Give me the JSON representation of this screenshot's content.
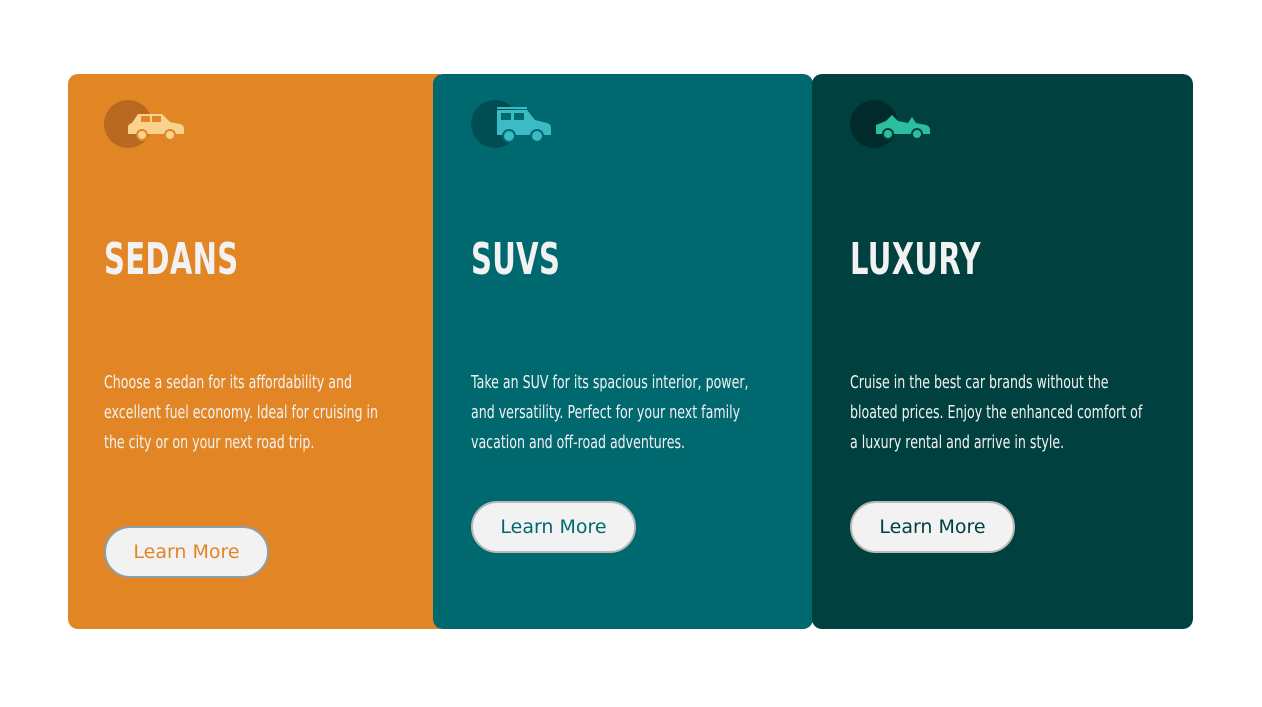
{
  "cards": [
    {
      "id": "sedans",
      "title": "SEDANS",
      "description": "Choose a sedan for its affordability and excellent fuel economy. Ideal for cruising in the city or on your next road trip.",
      "button_label": "Learn More",
      "icon": "sedan-car-icon",
      "background": "#e28625"
    },
    {
      "id": "suvs",
      "title": "SUVS",
      "description": "Take an SUV for its spacious interior, power, and versatility. Perfect for your next family vacation and off-road adventures.",
      "button_label": "Learn More",
      "icon": "suv-car-icon",
      "background": "#006970"
    },
    {
      "id": "luxury",
      "title": "LUXURY",
      "description": "Cruise in the best car brands without the bloated prices. Enjoy the enhanced comfort of a luxury rental and arrive in style.",
      "button_label": "Learn More",
      "icon": "luxury-car-icon",
      "background": "#004140"
    }
  ],
  "colors": {
    "sedans": "#e28625",
    "suvs": "#006970",
    "luxury": "#004140",
    "text": "#f2f2f2",
    "button_bg": "#f2f2f2"
  }
}
